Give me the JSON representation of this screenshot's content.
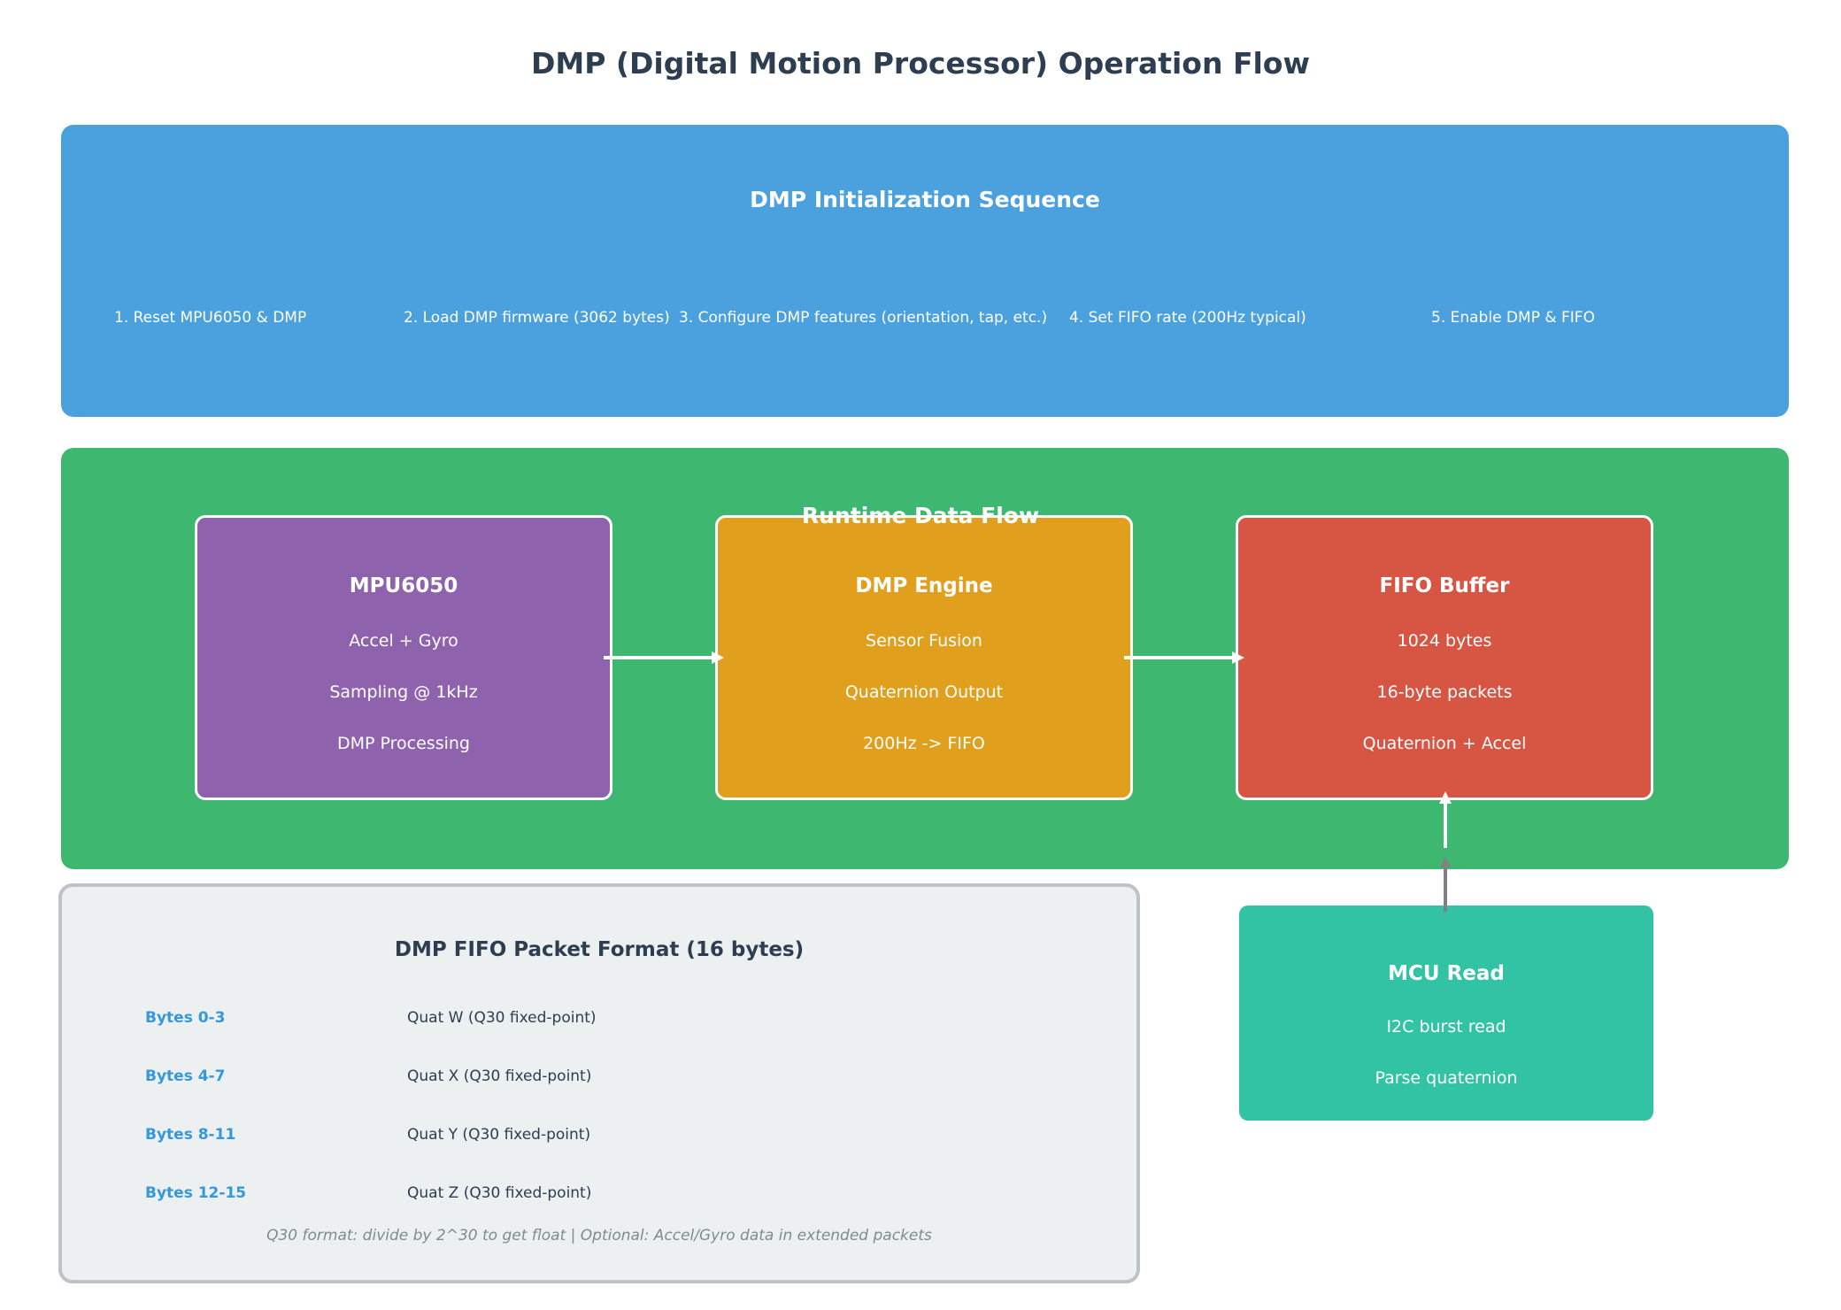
{
  "title": "DMP (Digital Motion Processor) Operation Flow",
  "init": {
    "title": "DMP Initialization Sequence",
    "steps": [
      "1. Reset MPU6050 & DMP",
      "2. Load DMP firmware (3062 bytes)",
      "3. Configure DMP features (orientation, tap, etc.)",
      "4. Set FIFO rate (200Hz typical)",
      "5. Enable DMP & FIFO"
    ]
  },
  "runtime": {
    "title": "Runtime Data Flow",
    "mpu": {
      "title": "MPU6050",
      "lines": [
        "Accel + Gyro",
        "Sampling @ 1kHz",
        "DMP Processing"
      ]
    },
    "dmp": {
      "title": "DMP Engine",
      "lines": [
        "Sensor Fusion",
        "Quaternion Output",
        "200Hz -> FIFO"
      ]
    },
    "fifo": {
      "title": "FIFO Buffer",
      "lines": [
        "1024 bytes",
        "16-byte packets",
        "Quaternion + Accel"
      ]
    }
  },
  "mcu": {
    "title": "MCU Read",
    "lines": [
      "I2C burst read",
      "Parse quaternion"
    ]
  },
  "packet": {
    "title": "DMP FIFO Packet Format (16 bytes)",
    "rows": [
      {
        "range": "Bytes 0-3",
        "desc": "Quat W (Q30 fixed-point)"
      },
      {
        "range": "Bytes 4-7",
        "desc": "Quat X (Q30 fixed-point)"
      },
      {
        "range": "Bytes 8-11",
        "desc": "Quat Y (Q30 fixed-point)"
      },
      {
        "range": "Bytes 12-15",
        "desc": "Quat Z (Q30 fixed-point)"
      }
    ],
    "note": "Q30 format: divide by 2^30 to get float | Optional: Accel/Gyro data in extended packets"
  },
  "colors": {
    "init_panel": "#4aa1de",
    "runtime_panel": "#3eb770",
    "mpu_box": "#8f62ad",
    "dmp_box": "#e0a01d",
    "fifo_box": "#d65643",
    "mcu_box": "#32c3a5",
    "packet_panel": "#ecf0f1",
    "range_text": "#3498db"
  }
}
